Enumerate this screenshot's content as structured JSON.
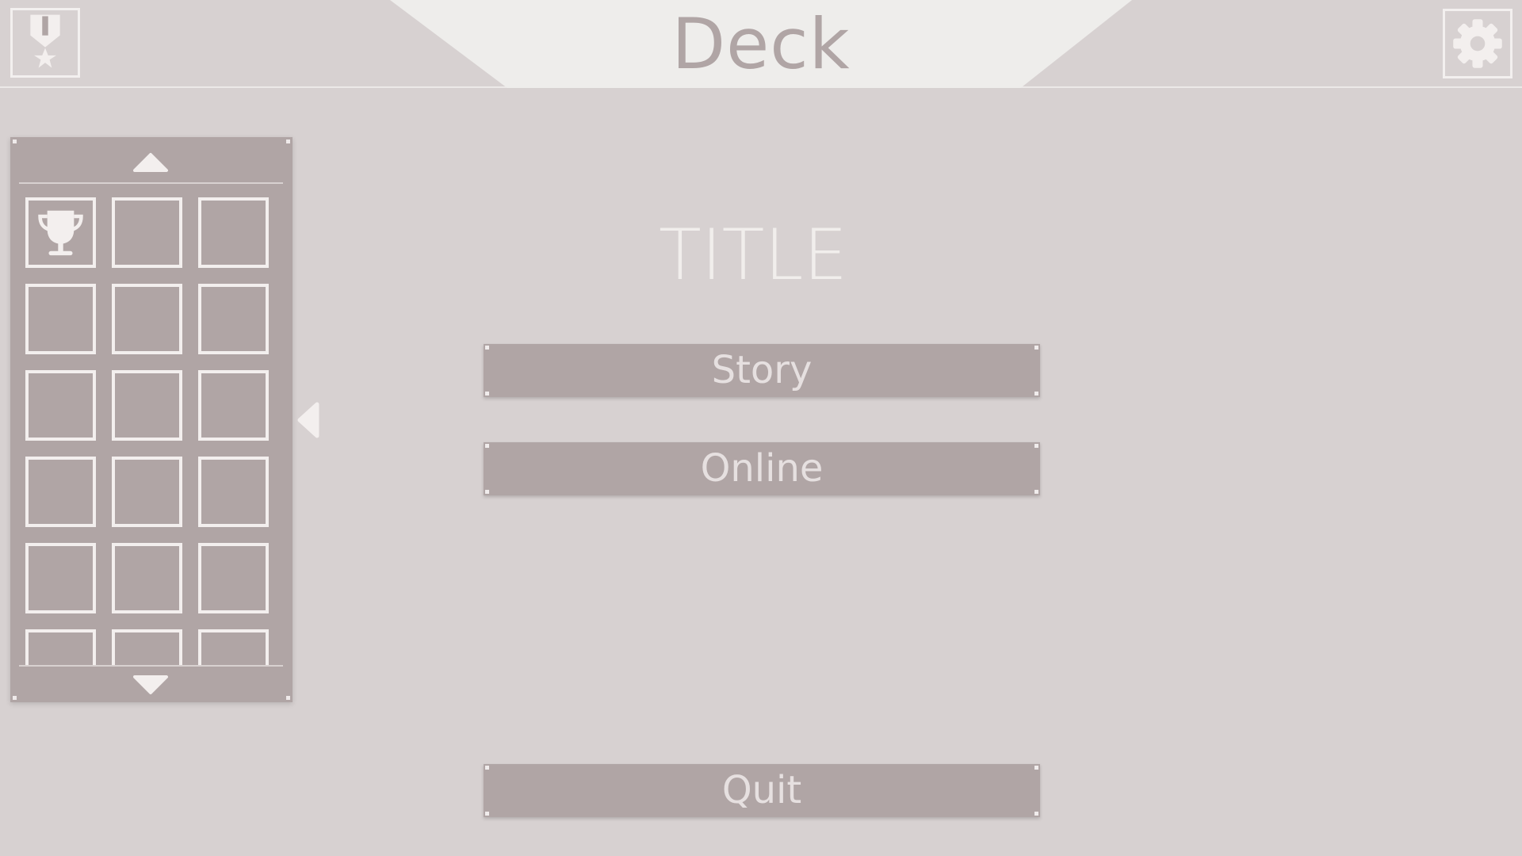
{
  "header": {
    "title": "Deck",
    "left_icon": "medal-icon",
    "right_icon": "gear-icon"
  },
  "sidebar": {
    "scroll_up_icon": "chevron-up-icon",
    "scroll_down_icon": "chevron-down-icon",
    "collapse_icon": "chevron-left-icon",
    "slots": [
      {
        "icon": "trophy-icon"
      },
      {
        "icon": ""
      },
      {
        "icon": ""
      },
      {
        "icon": ""
      },
      {
        "icon": ""
      },
      {
        "icon": ""
      },
      {
        "icon": ""
      },
      {
        "icon": ""
      },
      {
        "icon": ""
      },
      {
        "icon": ""
      },
      {
        "icon": ""
      },
      {
        "icon": ""
      },
      {
        "icon": ""
      },
      {
        "icon": ""
      },
      {
        "icon": ""
      },
      {
        "icon": ""
      },
      {
        "icon": ""
      },
      {
        "icon": ""
      }
    ]
  },
  "menu": {
    "title": "TITLE",
    "story_label": "Story",
    "online_label": "Online",
    "quit_label": "Quit"
  },
  "colors": {
    "background": "#d7d1d1",
    "panel": "#b0a5a5",
    "header_center": "#eeedeb",
    "outline": "#f3efee"
  }
}
